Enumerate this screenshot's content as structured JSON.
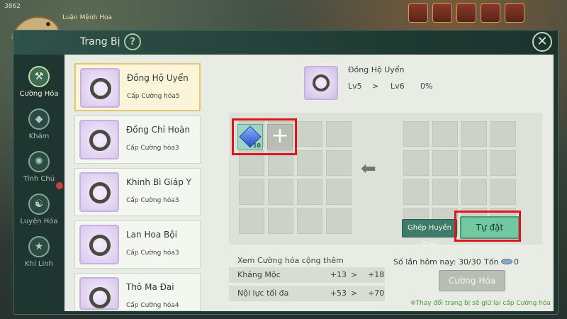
{
  "hud": {
    "level": "3862",
    "player_name": "Luận Mệnh Hoa"
  },
  "window": {
    "title": "Trang Bị",
    "help_label": "?",
    "close_label": "✕"
  },
  "side_tabs": [
    {
      "label": "Cường Hóa",
      "icon": "cuong-hoa-icon",
      "active": true
    },
    {
      "label": "Khảm",
      "icon": "kham-icon",
      "active": false
    },
    {
      "label": "Tinh Chú",
      "icon": "tinh-chu-icon",
      "active": false
    },
    {
      "label": "Luyện Hóa",
      "icon": "luyen-hoa-icon",
      "active": false
    },
    {
      "label": "Khí Linh",
      "icon": "khi-linh-icon",
      "active": false
    }
  ],
  "items": [
    {
      "name": "Đồng Hộ Uyển",
      "sub": "Cấp Cường hóa5",
      "selected": true
    },
    {
      "name": "Đồng Chỉ Hoàn",
      "sub": "Cấp Cường hóa3",
      "selected": false
    },
    {
      "name": "Khinh Bì Giáp Y",
      "sub": "Cấp Cường hóa3",
      "selected": false
    },
    {
      "name": "Lan Hoa Bội",
      "sub": "Cấp Cường hóa3",
      "selected": false
    },
    {
      "name": "Thô Ma Đai",
      "sub": "Cấp Cường hóa4",
      "selected": false
    }
  ],
  "preview": {
    "name": "Đồng Hộ Uyển",
    "lv_from": "Lv5",
    "arrow": ">",
    "lv_to": "Lv6",
    "percent": "0%"
  },
  "material": {
    "gem_count": "10",
    "add_symbol": "+"
  },
  "buttons": {
    "ghep": "Ghép Huyền Tinh",
    "tudat": "Tự đặt",
    "cuonghoa": "Cường Hóa"
  },
  "stats": {
    "title": "Xem Cường hóa cộng thêm",
    "rows": [
      {
        "name": "Kháng Mộc",
        "from": "+13",
        "arrow": ">",
        "to": "+18"
      },
      {
        "name": "Nội lực tối đa",
        "from": "+53",
        "arrow": ">",
        "to": "+70"
      }
    ]
  },
  "counts": {
    "today": "Số lần hôm nay: 30/30",
    "ton_label": "Tốn",
    "ton_value": "0"
  },
  "note": "※Thay đổi trang bị sẽ giữ lại cấp Cường hóa",
  "colors": {
    "highlight": "#e0141e",
    "primary_button": "#72c8a0",
    "secondary_button": "#3f7a6a"
  }
}
